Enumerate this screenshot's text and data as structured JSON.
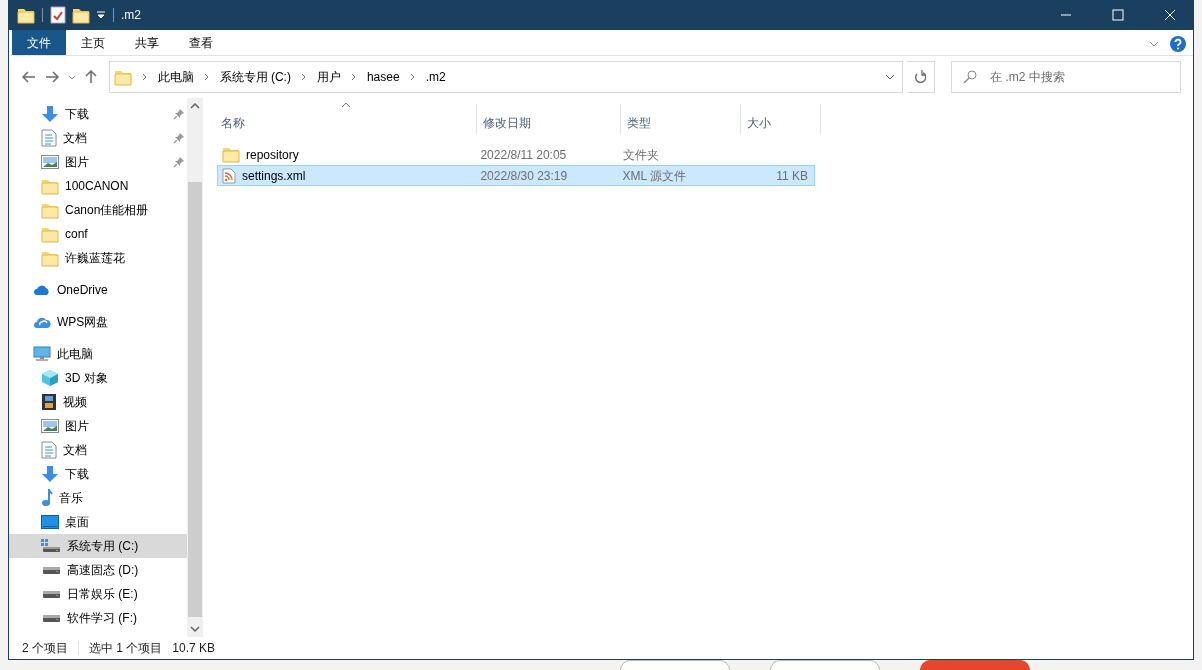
{
  "window": {
    "title": ".m2"
  },
  "ribbon": {
    "tabs": [
      {
        "label": "文件",
        "selected": true
      },
      {
        "label": "主页",
        "selected": false
      },
      {
        "label": "共享",
        "selected": false
      },
      {
        "label": "查看",
        "selected": false
      }
    ]
  },
  "address_bar": {
    "path": [
      "此电脑",
      "系统专用 (C:)",
      "用户",
      "hasee",
      ".m2"
    ]
  },
  "search": {
    "placeholder": "在 .m2 中搜索"
  },
  "sidebar": {
    "quick_access": [
      {
        "label": "下载",
        "kind": "download",
        "pinned": true,
        "selected": false
      },
      {
        "label": "文档",
        "kind": "document",
        "pinned": true,
        "selected": false
      },
      {
        "label": "图片",
        "kind": "pictures",
        "pinned": true,
        "selected": false
      },
      {
        "label": "100CANON",
        "kind": "folder",
        "pinned": false,
        "selected": false
      },
      {
        "label": "Canon佳能相册",
        "kind": "folder",
        "pinned": false,
        "selected": false
      },
      {
        "label": "conf",
        "kind": "folder",
        "pinned": false,
        "selected": false
      },
      {
        "label": "许巍蓝莲花",
        "kind": "folder",
        "pinned": false,
        "selected": false
      }
    ],
    "items": [
      {
        "label": "OneDrive",
        "kind": "onedrive",
        "selected": false
      },
      {
        "label": "WPS网盘",
        "kind": "wps",
        "selected": false
      },
      {
        "label": "此电脑",
        "kind": "pc",
        "selected": false,
        "children": [
          {
            "label": "3D 对象",
            "kind": "cube",
            "selected": false
          },
          {
            "label": "视频",
            "kind": "video",
            "selected": false
          },
          {
            "label": "图片",
            "kind": "pictures",
            "selected": false
          },
          {
            "label": "文档",
            "kind": "document",
            "selected": false
          },
          {
            "label": "下载",
            "kind": "download",
            "selected": false
          },
          {
            "label": "音乐",
            "kind": "music",
            "selected": false
          },
          {
            "label": "桌面",
            "kind": "desktop",
            "selected": false
          },
          {
            "label": "系统专用 (C:)",
            "kind": "systemdrive",
            "selected": true
          },
          {
            "label": "高速固态 (D:)",
            "kind": "drive",
            "selected": false
          },
          {
            "label": "日常娱乐 (E:)",
            "kind": "drive",
            "selected": false
          },
          {
            "label": "软件学习 (F:)",
            "kind": "drive",
            "selected": false
          }
        ]
      }
    ]
  },
  "files": {
    "columns": [
      {
        "label": "名称",
        "sorted": true
      },
      {
        "label": "修改日期",
        "sorted": false
      },
      {
        "label": "类型",
        "sorted": false
      },
      {
        "label": "大小",
        "sorted": false
      }
    ],
    "rows": [
      {
        "name": "repository",
        "modified": "2022/8/11 20:05",
        "type": "文件夹",
        "size": "",
        "kind": "folder",
        "selected": false
      },
      {
        "name": "settings.xml",
        "modified": "2022/8/30 23:19",
        "type": "XML 源文件",
        "size": "11 KB",
        "kind": "xml",
        "selected": true
      }
    ]
  },
  "status_bar": {
    "item_count": "2 个项目",
    "selection": "选中 1 个项目",
    "size": "10.7 KB"
  }
}
